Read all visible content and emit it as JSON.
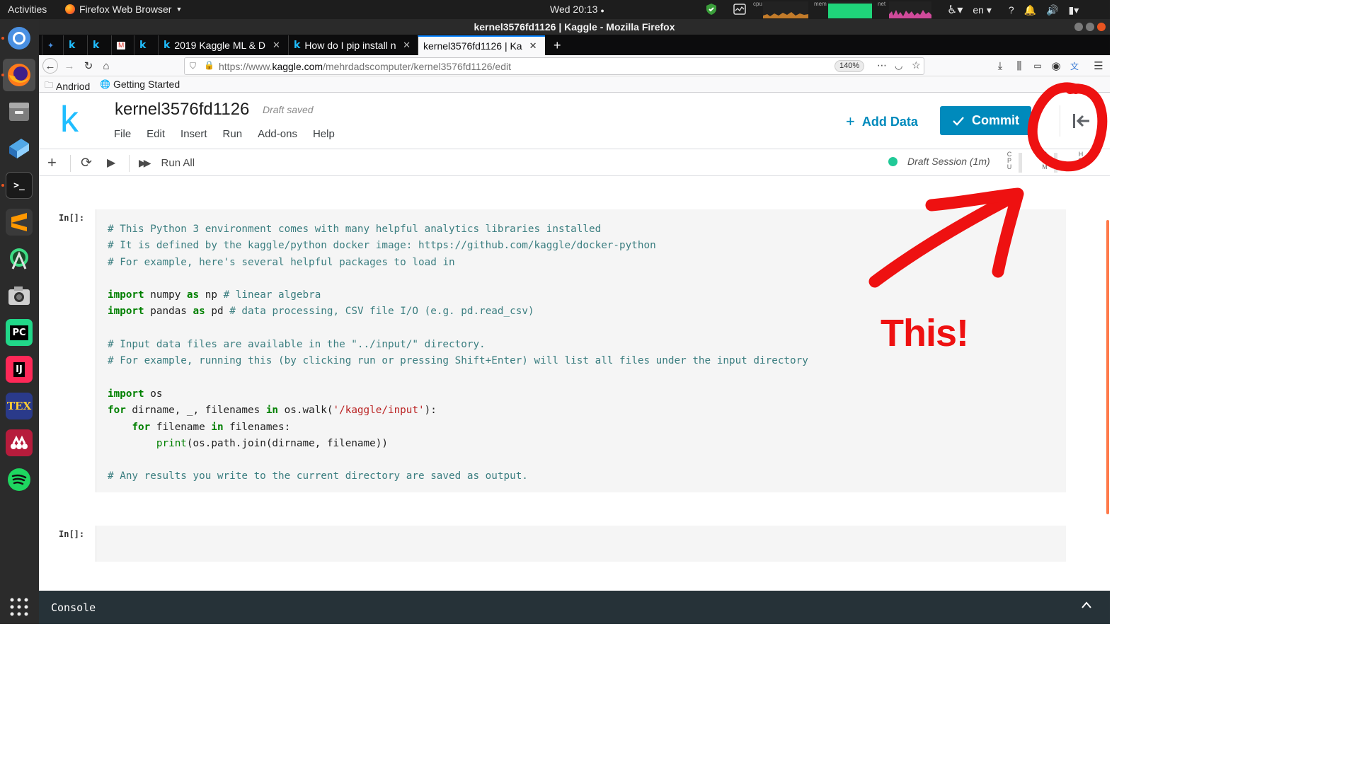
{
  "topbar": {
    "activities": "Activities",
    "app_name": "Firefox Web Browser",
    "clock": "Wed 20:13",
    "monitor_labels": {
      "cpu": "cpu",
      "mem": "mem",
      "net": "net"
    },
    "language": "en"
  },
  "window": {
    "title": "kernel3576fd1126 | Kaggle - Mozilla Firefox"
  },
  "tabs": [
    {
      "label": "",
      "icon": "pinned-star-icon"
    },
    {
      "label": "k",
      "icon": "kaggle-icon"
    },
    {
      "label": "k",
      "icon": "kaggle-icon"
    },
    {
      "label": "",
      "icon": "gmail-icon"
    },
    {
      "label": "k",
      "icon": "kaggle-icon"
    },
    {
      "label": "2019 Kaggle ML & D",
      "icon": "kaggle-icon"
    },
    {
      "label": "How do I pip install n",
      "icon": "kaggle-icon"
    },
    {
      "label": "kernel3576fd1126 | Ka",
      "icon": "kaggle-icon",
      "active": true
    }
  ],
  "nav": {
    "url_prefix": "https://www.",
    "url_host": "kaggle.com",
    "url_path": "/mehrdadscomputer/kernel3576fd1126/edit",
    "zoom": "140%"
  },
  "bookmarks": [
    {
      "label": "Andriod",
      "icon": "folder-icon"
    },
    {
      "label": "Getting Started",
      "icon": "globe-icon"
    }
  ],
  "kaggle": {
    "logo": "k",
    "notebook_title": "kernel3576fd1126",
    "draft_status": "Draft saved",
    "menu": [
      "File",
      "Edit",
      "Insert",
      "Run",
      "Add-ons",
      "Help"
    ],
    "add_data": "Add Data",
    "commit": "Commit",
    "run_all": "Run All",
    "session": "Draft Session (1m)",
    "meters": {
      "cpu": "CPU",
      "ram": "RAM",
      "hdd": "HDD"
    },
    "accent": "#20beff",
    "button_color": "#008abc"
  },
  "cells": [
    {
      "prompt": "In[]:",
      "lines": [
        [
          [
            "com",
            "# This Python 3 environment comes with many helpful analytics libraries installed"
          ]
        ],
        [
          [
            "com",
            "# It is defined by the kaggle/python docker image: https://github.com/kaggle/docker-python"
          ]
        ],
        [
          [
            "com",
            "# For example, here's several helpful packages to load in"
          ]
        ],
        [],
        [
          [
            "kw",
            "import"
          ],
          [
            "t",
            " numpy "
          ],
          [
            "kw",
            "as"
          ],
          [
            "t",
            " np "
          ],
          [
            "com",
            "# linear algebra"
          ]
        ],
        [
          [
            "kw",
            "import"
          ],
          [
            "t",
            " pandas "
          ],
          [
            "kw",
            "as"
          ],
          [
            "t",
            " pd "
          ],
          [
            "com",
            "# data processing, CSV file I/O (e.g. pd.read_csv)"
          ]
        ],
        [],
        [
          [
            "com",
            "# Input data files are available in the \"../input/\" directory."
          ]
        ],
        [
          [
            "com",
            "# For example, running this (by clicking run or pressing Shift+Enter) will list all files under the input directory"
          ]
        ],
        [],
        [
          [
            "kw",
            "import"
          ],
          [
            "t",
            " os"
          ]
        ],
        [
          [
            "kw",
            "for"
          ],
          [
            "t",
            " dirname, _, filenames "
          ],
          [
            "kw",
            "in"
          ],
          [
            "t",
            " os.walk("
          ],
          [
            "str",
            "'/kaggle/input'"
          ],
          [
            "t",
            "):"
          ]
        ],
        [
          [
            "t",
            "    "
          ],
          [
            "kw",
            "for"
          ],
          [
            "t",
            " filename "
          ],
          [
            "kw",
            "in"
          ],
          [
            "t",
            " filenames:"
          ]
        ],
        [
          [
            "t",
            "        "
          ],
          [
            "bi",
            "print"
          ],
          [
            "t",
            "(os.path.join(dirname, filename))"
          ]
        ],
        [],
        [
          [
            "com",
            "# Any results you write to the current directory are saved as output."
          ]
        ]
      ]
    },
    {
      "prompt": "In[]:",
      "lines": []
    }
  ],
  "console": {
    "label": "Console"
  },
  "annotation": {
    "text": "This!",
    "color": "#ee1111"
  }
}
